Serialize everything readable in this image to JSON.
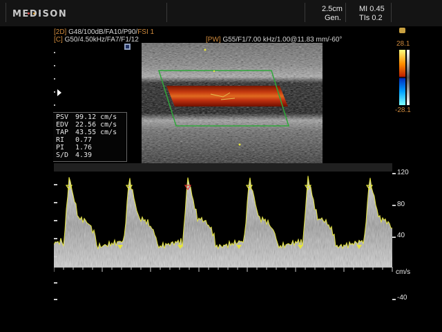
{
  "header": {
    "brand": "MEDISON",
    "depth": "2.5cm",
    "freq_mode": "Gen.",
    "mi": "MI 0.45",
    "tis": "TIs 0.2",
    "logo_dot_colors": [
      "#e05050",
      "#e0a030",
      "#5090e0"
    ]
  },
  "params": {
    "mode2d_tag": "[2D]",
    "mode2d_values": "G48/100dB/FA10/P90/",
    "mode2d_fsi": "FSI 1",
    "color_tag": "[C]",
    "color_values": "G50/4.50kHz/FA7/F1/12",
    "pw_tag": "[PW]",
    "pw_values": "G55/F1/7.00 kHz/1.00@11.83 mm/-60°"
  },
  "measurements": [
    {
      "label": "PSV",
      "value": "99.12 cm/s"
    },
    {
      "label": "EDV",
      "value": "22.56 cm/s"
    },
    {
      "label": "TAP",
      "value": "43.55 cm/s"
    },
    {
      "label": "RI",
      "value": "0.77"
    },
    {
      "label": "PI",
      "value": "1.76"
    },
    {
      "label": "S/D",
      "value": "4.39"
    }
  ],
  "color_scale": {
    "top": "28.1",
    "bottom": "-28.1"
  },
  "doppler_scale": {
    "labels": [
      "120",
      "80",
      "40",
      "-40"
    ],
    "unit": "cm/s"
  },
  "colors": {
    "param_orange": "#d08a3c",
    "roi_green": "#2fa83a",
    "trace_yellow": "#e6e640",
    "peak_marker_red": "#e03a3a"
  }
}
